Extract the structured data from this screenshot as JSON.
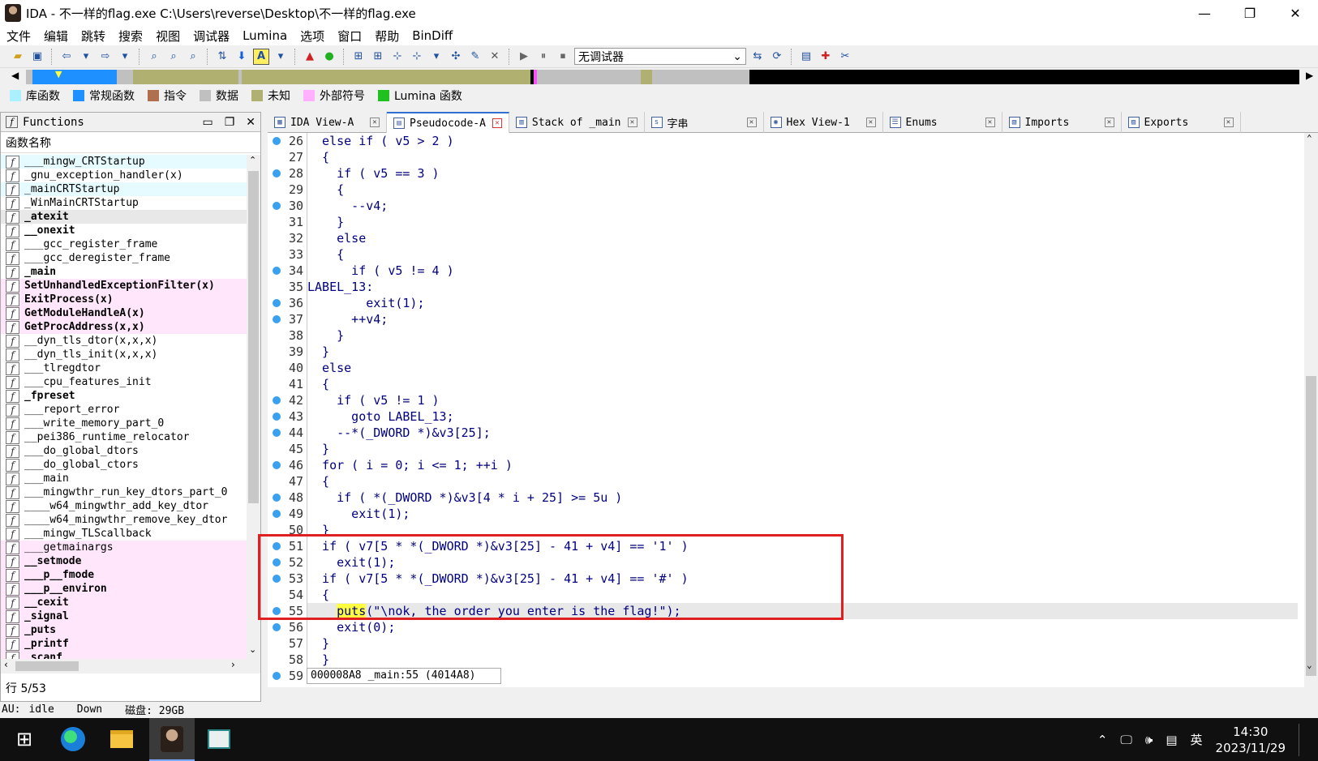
{
  "window": {
    "title": "IDA - 不一样的flag.exe C:\\Users\\reverse\\Desktop\\不一样的flag.exe",
    "min": "—",
    "max": "❐",
    "close": "✕"
  },
  "menu": [
    "文件",
    "编辑",
    "跳转",
    "搜索",
    "视图",
    "调试器",
    "Lumina",
    "选项",
    "窗口",
    "帮助",
    "BinDiff"
  ],
  "toolbar": {
    "debugger": "无调试器"
  },
  "legend": [
    {
      "label": "库函数",
      "color": "#aaf0ff"
    },
    {
      "label": "常规函数",
      "color": "#1e90ff"
    },
    {
      "label": "指令",
      "color": "#b07050"
    },
    {
      "label": "数据",
      "color": "#c0c0c0"
    },
    {
      "label": "未知",
      "color": "#b0b070"
    },
    {
      "label": "外部符号",
      "color": "#ffb0ff"
    },
    {
      "label": "Lumina 函数",
      "color": "#20c020"
    }
  ],
  "functions_panel": {
    "title": "Functions",
    "column": "函数名称",
    "items": [
      {
        "name": "___mingw_CRTStartup",
        "kind": "lib"
      },
      {
        "name": "_gnu_exception_handler(x)",
        "kind": ""
      },
      {
        "name": "_mainCRTStartup",
        "kind": "lib"
      },
      {
        "name": "_WinMainCRTStartup",
        "kind": ""
      },
      {
        "name": "_atexit",
        "kind": "sel bold"
      },
      {
        "name": "__onexit",
        "kind": "bold"
      },
      {
        "name": "___gcc_register_frame",
        "kind": ""
      },
      {
        "name": "___gcc_deregister_frame",
        "kind": ""
      },
      {
        "name": "_main",
        "kind": "bold"
      },
      {
        "name": "SetUnhandledExceptionFilter(x)",
        "kind": "imp bold"
      },
      {
        "name": "ExitProcess(x)",
        "kind": "imp bold"
      },
      {
        "name": "GetModuleHandleA(x)",
        "kind": "imp bold"
      },
      {
        "name": "GetProcAddress(x,x)",
        "kind": "imp bold"
      },
      {
        "name": "__dyn_tls_dtor(x,x,x)",
        "kind": ""
      },
      {
        "name": "__dyn_tls_init(x,x,x)",
        "kind": ""
      },
      {
        "name": "___tlregdtor",
        "kind": ""
      },
      {
        "name": "___cpu_features_init",
        "kind": ""
      },
      {
        "name": "_fpreset",
        "kind": "bold"
      },
      {
        "name": "___report_error",
        "kind": ""
      },
      {
        "name": "___write_memory_part_0",
        "kind": ""
      },
      {
        "name": "__pei386_runtime_relocator",
        "kind": ""
      },
      {
        "name": "___do_global_dtors",
        "kind": ""
      },
      {
        "name": "___do_global_ctors",
        "kind": ""
      },
      {
        "name": "___main",
        "kind": ""
      },
      {
        "name": "___mingwthr_run_key_dtors_part_0",
        "kind": ""
      },
      {
        "name": "____w64_mingwthr_add_key_dtor",
        "kind": ""
      },
      {
        "name": "____w64_mingwthr_remove_key_dtor",
        "kind": ""
      },
      {
        "name": "___mingw_TLScallback",
        "kind": ""
      },
      {
        "name": "___getmainargs",
        "kind": "imp"
      },
      {
        "name": "__setmode",
        "kind": "imp bold"
      },
      {
        "name": "___p__fmode",
        "kind": "imp bold"
      },
      {
        "name": "___p__environ",
        "kind": "imp bold"
      },
      {
        "name": "__cexit",
        "kind": "imp bold"
      },
      {
        "name": "_signal",
        "kind": "imp bold"
      },
      {
        "name": "_puts",
        "kind": "imp bold"
      },
      {
        "name": "_printf",
        "kind": "imp bold"
      },
      {
        "name": "_scanf",
        "kind": "imp bold"
      }
    ],
    "line_pos": "行 5/53"
  },
  "tabs": [
    {
      "label": "IDA View-A",
      "icon": "▦"
    },
    {
      "label": "Pseudocode-A",
      "icon": "▤",
      "active": true
    },
    {
      "label": "Stack of _main",
      "icon": "▥"
    },
    {
      "label": "字串",
      "icon": "s"
    },
    {
      "label": "Hex View-1",
      "icon": "◉"
    },
    {
      "label": "Enums",
      "icon": "☰"
    },
    {
      "label": "Imports",
      "icon": "▧"
    },
    {
      "label": "Exports",
      "icon": "▨"
    }
  ],
  "code": [
    {
      "n": "26",
      "dot": true,
      "t": "  else if ( v5 > 2 )"
    },
    {
      "n": "27",
      "dot": false,
      "t": "  {"
    },
    {
      "n": "28",
      "dot": true,
      "t": "    if ( v5 == 3 )"
    },
    {
      "n": "29",
      "dot": false,
      "t": "    {"
    },
    {
      "n": "30",
      "dot": true,
      "t": "      --v4;"
    },
    {
      "n": "31",
      "dot": false,
      "t": "    }"
    },
    {
      "n": "32",
      "dot": false,
      "t": "    else"
    },
    {
      "n": "33",
      "dot": false,
      "t": "    {"
    },
    {
      "n": "34",
      "dot": true,
      "t": "      if ( v5 != 4 )"
    },
    {
      "n": "35",
      "dot": false,
      "t": "LABEL_13:"
    },
    {
      "n": "36",
      "dot": true,
      "t": "        exit(1);"
    },
    {
      "n": "37",
      "dot": true,
      "t": "      ++v4;"
    },
    {
      "n": "38",
      "dot": false,
      "t": "    }"
    },
    {
      "n": "39",
      "dot": false,
      "t": "  }"
    },
    {
      "n": "40",
      "dot": false,
      "t": "  else"
    },
    {
      "n": "41",
      "dot": false,
      "t": "  {"
    },
    {
      "n": "42",
      "dot": true,
      "t": "    if ( v5 != 1 )"
    },
    {
      "n": "43",
      "dot": true,
      "t": "      goto LABEL_13;"
    },
    {
      "n": "44",
      "dot": true,
      "t": "    --*(_DWORD *)&v3[25];"
    },
    {
      "n": "45",
      "dot": false,
      "t": "  }"
    },
    {
      "n": "46",
      "dot": true,
      "t": "  for ( i = 0; i <= 1; ++i )"
    },
    {
      "n": "47",
      "dot": false,
      "t": "  {"
    },
    {
      "n": "48",
      "dot": true,
      "t": "    if ( *(_DWORD *)&v3[4 * i + 25] >= 5u )"
    },
    {
      "n": "49",
      "dot": true,
      "t": "      exit(1);"
    },
    {
      "n": "50",
      "dot": false,
      "t": "  }"
    },
    {
      "n": "51",
      "dot": true,
      "t": "  if ( v7[5 * *(_DWORD *)&v3[25] - 41 + v4] == '1' )"
    },
    {
      "n": "52",
      "dot": true,
      "t": "    exit(1);"
    },
    {
      "n": "53",
      "dot": true,
      "t": "  if ( v7[5 * *(_DWORD *)&v3[25] - 41 + v4] == '#' )"
    },
    {
      "n": "54",
      "dot": false,
      "t": "  {"
    },
    {
      "n": "55",
      "dot": true,
      "t_pre": "    ",
      "t_hl": "puts",
      "t_post": "(\"\\nok, the order you enter is the flag!\");",
      "cur": true
    },
    {
      "n": "56",
      "dot": true,
      "t": "    exit(0);"
    },
    {
      "n": "57",
      "dot": false,
      "t": "  }"
    },
    {
      "n": "58",
      "dot": false,
      "t": "  }"
    },
    {
      "n": "59",
      "dot": true,
      "t": "}"
    }
  ],
  "address_bar": "000008A8 _main:55 (4014A8)",
  "status": {
    "au": "AU:",
    "state": "idle",
    "dir": "Down",
    "disk": "磁盘: 29GB"
  },
  "taskbar": {
    "time": "14:30",
    "date": "2023/11/29",
    "ime": "英"
  }
}
